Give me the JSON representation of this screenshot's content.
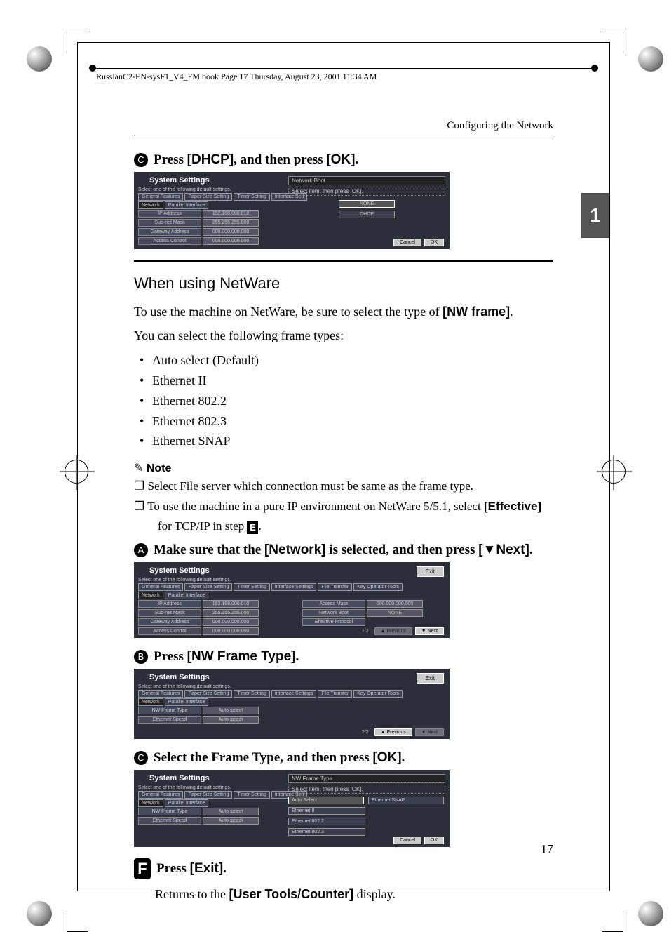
{
  "book_info": "RussianC2-EN-sysF1_V4_FM.book  Page 17  Thursday, August 23, 2001  11:34 AM",
  "running_head": "Configuring the Network",
  "side_tab": "1",
  "page_number": "17",
  "step_c": {
    "num": "C",
    "pre": "Press ",
    "btn1": "[DHCP]",
    "mid": ", and then press ",
    "btn2": "[OK]",
    "post": "."
  },
  "shot1": {
    "title": "System Settings",
    "sub": "Select one of the following default settings.",
    "tabs": [
      "General Features",
      "Paper Size Setting",
      "Timer Setting",
      "Interface Sett"
    ],
    "subtabs": [
      "Network",
      "Parallel Interface"
    ],
    "rows": [
      {
        "k": "IP Address",
        "v": "192.168.000.010"
      },
      {
        "k": "Sub-net Mask",
        "v": "255.255.255.000"
      },
      {
        "k": "Gateway Address",
        "v": "000.000.000.000"
      },
      {
        "k": "Access Control",
        "v": "000.000.000.000"
      }
    ],
    "right_title": "Network Boot",
    "right_sub": "Select item, then press [OK].",
    "opts": [
      "NONE",
      "DHCP"
    ],
    "cancel": "Cancel",
    "ok": "OK"
  },
  "section_netware": {
    "heading": "When using NetWare",
    "p1a": "To use the machine on NetWare, be sure to select the type of ",
    "p1b": "[NW frame]",
    "p1c": ".",
    "p2": "You can select the following frame types:",
    "frames": [
      "Auto select (Default)",
      "Ethernet II",
      "Ethernet 802.2",
      "Ethernet 802.3",
      "Ethernet SNAP"
    ]
  },
  "note": {
    "head": "Note",
    "n1": "Select File server which connection must be same as the frame type.",
    "n2a": "To use the machine in a pure IP environment on NetWare 5/5.1, select ",
    "n2b": "[Effective]",
    "n2c": " for TCP/IP in step ",
    "n2d": "E",
    "n2e": "."
  },
  "step_a": {
    "num": "A",
    "pre": "Make sure that the ",
    "btn1": "[Network]",
    "mid": " is selected, and then press ",
    "btn2": "[▼Next]",
    "post": "."
  },
  "shot2": {
    "title": "System Settings",
    "sub": "Select one of the following default settings.",
    "tabs": [
      "General Features",
      "Paper Size Setting",
      "Timer Setting",
      "Interface Settings",
      "File Transfer",
      "Key Operator Tools"
    ],
    "subtabs": [
      "Network",
      "Parallel Interface"
    ],
    "left_rows": [
      {
        "k": "IP Address",
        "v": "192.168.000.010"
      },
      {
        "k": "Sub-net Mask",
        "v": "255.255.255.000"
      },
      {
        "k": "Gateway Address",
        "v": "000.000.000.000"
      },
      {
        "k": "Access Control",
        "v": "000.000.000.000"
      }
    ],
    "right_rows": [
      {
        "k": "Access Mask",
        "v": "000.000.000.000"
      },
      {
        "k": "Network Boot",
        "v": "NONE"
      },
      {
        "k": "Effective Protocol",
        "v": ""
      }
    ],
    "exit": "Exit",
    "page": "1/2",
    "prev": "▲ Previous",
    "next": "▼ Next"
  },
  "step_b": {
    "num": "B",
    "pre": "Press ",
    "btn1": "[NW Frame Type]",
    "post": "."
  },
  "shot3": {
    "title": "System Settings",
    "sub": "Select one of the following default settings.",
    "tabs": [
      "General Features",
      "Paper Size Setting",
      "Timer Setting",
      "Interface Settings",
      "File Transfer",
      "Key Operator Tools"
    ],
    "subtabs": [
      "Network",
      "Parallel Interface"
    ],
    "rows": [
      {
        "k": "NW Frame Type",
        "v": "Auto select"
      },
      {
        "k": "Ethernet Speed",
        "v": "Auto select"
      }
    ],
    "exit": "Exit",
    "page": "2/2",
    "prev": "▲ Previous",
    "next": "▼ Next"
  },
  "step_c2": {
    "num": "C",
    "pre": "Select the Frame Type, and then press ",
    "btn1": "[OK]",
    "post": "."
  },
  "shot4": {
    "title": "System Settings",
    "sub": "Select one of the following default settings.",
    "tabs": [
      "General Features",
      "Paper Size Setting",
      "Timer Setting",
      "Interface Sett"
    ],
    "subtabs": [
      "Network",
      "Parallel Interface"
    ],
    "rows": [
      {
        "k": "NW Frame Type",
        "v": "Auto select"
      },
      {
        "k": "Ethernet Speed",
        "v": "Auto select"
      }
    ],
    "right_title": "NW Frame Type",
    "right_sub": "Select item, then press [OK].",
    "opts": [
      "Auto Select",
      "Ethernet SNAP",
      "Ethernet II",
      "Ethernet 802.2",
      "Ethernet 802.3"
    ],
    "cancel": "Cancel",
    "ok": "OK"
  },
  "step_f": {
    "num": "F",
    "pre": "Press ",
    "btn1": "[Exit]",
    "post": ".",
    "body_a": "Returns to the ",
    "body_b": "[User Tools/Counter]",
    "body_c": " display."
  }
}
